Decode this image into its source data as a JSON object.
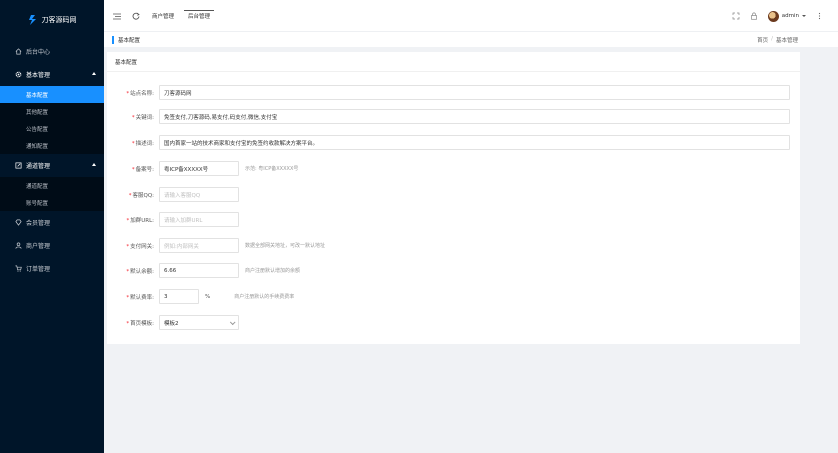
{
  "app": {
    "name": "刀客源码网"
  },
  "sidebar": {
    "items": [
      {
        "label": "后台中心"
      },
      {
        "label": "基本管理",
        "sub": [
          "基本配置",
          "其他配置",
          "公告配置",
          "通知配置"
        ]
      },
      {
        "label": "通道管理",
        "sub": [
          "通道配置",
          "账号配置"
        ]
      },
      {
        "label": "会员管理"
      },
      {
        "label": "商户管理"
      },
      {
        "label": "订单管理"
      }
    ]
  },
  "header": {
    "tabs": [
      "商户管理",
      "后台管理"
    ],
    "user": "admin"
  },
  "breadcrumb": {
    "title": "基本配置",
    "home": "首页",
    "separator": "/",
    "current": "基本管理"
  },
  "card": {
    "title": "基本配置"
  },
  "form": {
    "site_name": {
      "label": "站点名称:",
      "value": "刀客源码网"
    },
    "keywords": {
      "label": "关键词:",
      "value": "免签支付,刀客源码,易支付,码支付,微信,支付宝"
    },
    "description": {
      "label": "描述词:",
      "value": "国内首家一站的技术商家和支付宝的免签约收款解决方案平台。"
    },
    "icp": {
      "label": "备案号:",
      "value": "粤ICP备XXXXX号",
      "hint": "示范: 粤ICP备XXXXX号"
    },
    "qq": {
      "label": "客服QQ:",
      "placeholder": "请输入客服QQ"
    },
    "group": {
      "label": "加群URL:",
      "placeholder": "请输入加群URL"
    },
    "gateway": {
      "label": "支付网关:",
      "placeholder": "例如:内部网关",
      "hint": "数据全部网关地址，可改一默认地址"
    },
    "balance": {
      "label": "默认余额:",
      "value": "6.66",
      "hint": "商户注册默认增加的余额"
    },
    "rate": {
      "label": "默认费率:",
      "value": "3",
      "unit": "%",
      "hint": "商户注册默认的手续费费率"
    },
    "template": {
      "label": "首页模板:",
      "value": "模板2"
    }
  }
}
